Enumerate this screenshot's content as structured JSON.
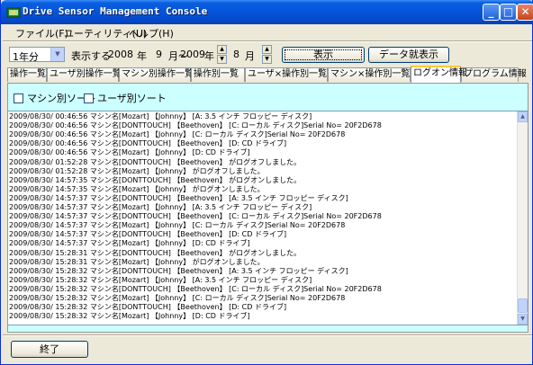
{
  "window": {
    "title": "Drive Sensor Management Console"
  },
  "menu": [
    "ファイル(F)",
    "ユーティリティ(U)",
    "ヘルプ(H)"
  ],
  "toolbar": {
    "period": "1年分",
    "display_label": "表示する",
    "from_year": "2008",
    "year_label_1": "年",
    "from_month": "9",
    "month_label_1": "月～",
    "to_year": "2009",
    "year_label_2": "年",
    "to_month": "8",
    "month_label_2": "月",
    "show_button": "表示",
    "batch_button": "データ就表示"
  },
  "tabs": [
    "操作一覧",
    "ユーザ別操作一覧",
    "マシン別操作一覧",
    "操作別一覧",
    "ユーザ×操作別一覧",
    "マシン×操作別一覧",
    "ログオン情報",
    "プログラム情報"
  ],
  "active_tab": "ログオン情報",
  "options": {
    "machine_sort": "マシン別ソート",
    "user_sort": "ユーザ別ソート"
  },
  "log": [
    "2009/08/30/ 00:46:56 マシン名[Mozart] 【Johnny】 [A: 3.5 インチ フロッピー ディスク]",
    "2009/08/30/ 00:46:56 マシン名[DONTTOUCH] 【Beethoven】 [C: ローカル ディスク]Serial No= 20F2D678",
    "2009/08/30/ 00:46:56 マシン名[Mozart] 【Johnny】 [C: ローカル ディスク]Serial No= 20F2D678",
    "2009/08/30/ 00:46:56 マシン名[DONTTOUCH] 【Beethoven】 [D: CD ドライブ]",
    "2009/08/30/ 00:46:56 マシン名[Mozart] 【Johnny】 [D: CD ドライブ]",
    "2009/08/30/ 01:52:28 マシン名[DONTTOUCH] 【Beethoven】 がログオフしました。",
    "2009/08/30/ 01:52:28 マシン名[Mozart] 【Johnny】 がログオフしました。",
    "2009/08/30/ 14:57:35 マシン名[DONTTOUCH] 【Beethoven】 がログオンしました。",
    "2009/08/30/ 14:57:35 マシン名[Mozart] 【Johnny】 がログオンしました。",
    "2009/08/30/ 14:57:37 マシン名[DONTTOUCH] 【Beethoven】 [A: 3.5 インチ フロッピー ディスク]",
    "2009/08/30/ 14:57:37 マシン名[Mozart] 【Johnny】 [A: 3.5 インチ フロッピー ディスク]",
    "2009/08/30/ 14:57:37 マシン名[DONTTOUCH] 【Beethoven】 [C: ローカル ディスク]Serial No= 20F2D678",
    "2009/08/30/ 14:57:37 マシン名[Mozart] 【Johnny】 [C: ローカル ディスク]Serial No= 20F2D678",
    "2009/08/30/ 14:57:37 マシン名[DONTTOUCH] 【Beethoven】 [D: CD ドライブ]",
    "2009/08/30/ 14:57:37 マシン名[Mozart] 【Johnny】 [D: CD ドライブ]",
    "2009/08/30/ 15:28:31 マシン名[DONTTOUCH] 【Beethoven】 がログオンしました。",
    "2009/08/30/ 15:28:31 マシン名[Mozart] 【Johnny】 がログオンしました。",
    "2009/08/30/ 15:28:32 マシン名[DONTTOUCH] 【Beethoven】 [A: 3.5 インチ フロッピー ディスク]",
    "2009/08/30/ 15:28:32 マシン名[Mozart] 【Johnny】 [A: 3.5 インチ フロッピー ディスク]",
    "2009/08/30/ 15:28:32 マシン名[DONTTOUCH] 【Beethoven】 [C: ローカル ディスク]Serial No= 20F2D678",
    "2009/08/30/ 15:28:32 マシン名[Mozart] 【Johnny】 [C: ローカル ディスク]Serial No= 20F2D678",
    "2009/08/30/ 15:28:32 マシン名[DONTTOUCH] 【Beethoven】 [D: CD ドライブ]",
    "2009/08/30/ 15:28:32 マシン名[Mozart] 【Johnny】 [D: CD ドライブ]"
  ],
  "footer": {
    "exit_button": "終了"
  },
  "icons": {
    "app": "drive-sensor-icon",
    "minimize": "minimize-icon",
    "maximize": "maximize-icon",
    "close": "close-icon",
    "dropdown": "chevron-down-icon",
    "spin_up": "spin-up-icon",
    "spin_down": "spin-down-icon",
    "scroll_up": "scroll-up-icon",
    "scroll_down": "scroll-down-icon"
  },
  "colors": {
    "titlebar": "#0653d9",
    "panel_background": "#ccffff",
    "active_tab_highlight": "#ffc83c"
  }
}
